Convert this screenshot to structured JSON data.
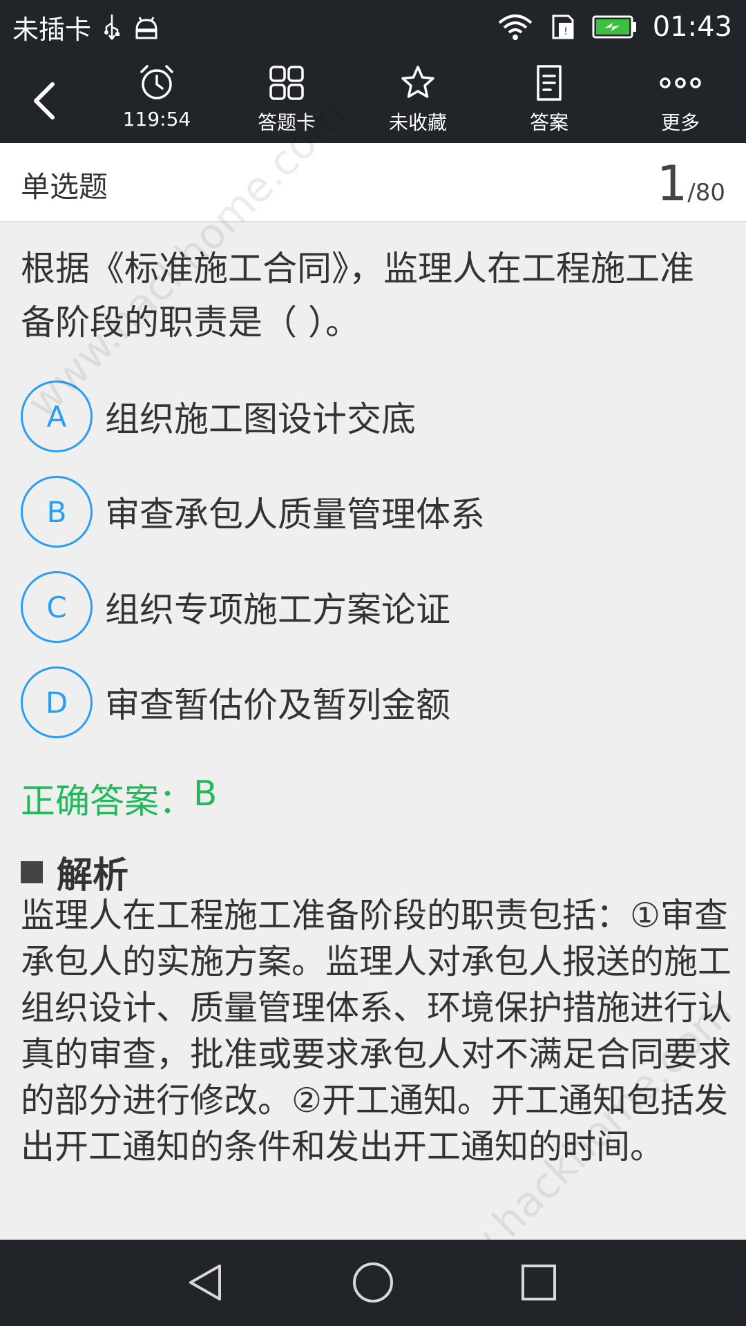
{
  "status_bar": {
    "carrier": "未插卡",
    "time": "01:43",
    "icons": [
      "usb-icon",
      "android-debug-icon",
      "wifi-icon",
      "sim-icon",
      "battery-charging-icon"
    ]
  },
  "toolbar": {
    "timer": "119:54",
    "answer_card": "答题卡",
    "favorite": "未收藏",
    "answer": "答案",
    "more": "更多"
  },
  "question_header": {
    "type": "单选题",
    "current": "1",
    "total": "/80"
  },
  "question": {
    "text": "根据《标准施工合同》，监理人在工程施工准备阶段的职责是（     ）。"
  },
  "options": [
    {
      "letter": "A",
      "text": "组织施工图设计交底"
    },
    {
      "letter": "B",
      "text": "审查承包人质量管理体系"
    },
    {
      "letter": "C",
      "text": "组织专项施工方案论证"
    },
    {
      "letter": "D",
      "text": "审查暂估价及暂列金额"
    }
  ],
  "answer": {
    "label": "正确答案：",
    "value": "B"
  },
  "analysis": {
    "title": "解析",
    "text": "监理人在工程施工准备阶段的职责包括：①审查承包人的实施方案。监理人对承包人报送的施工组织设计、质量管理体系、环境保护措施进行认真的审查，批准或要求承包人对不满足合同要求的部分进行修改。②开工通知。开工通知包括发出开工通知的条件和发出开工通知的时间。"
  },
  "watermark": {
    "text_top": "www.hackhome.com",
    "text_bottom": "www.hackhome.com"
  },
  "colors": {
    "bar_bg": "#212529",
    "option_blue": "#2a9df4",
    "answer_green": "#22b95a"
  }
}
